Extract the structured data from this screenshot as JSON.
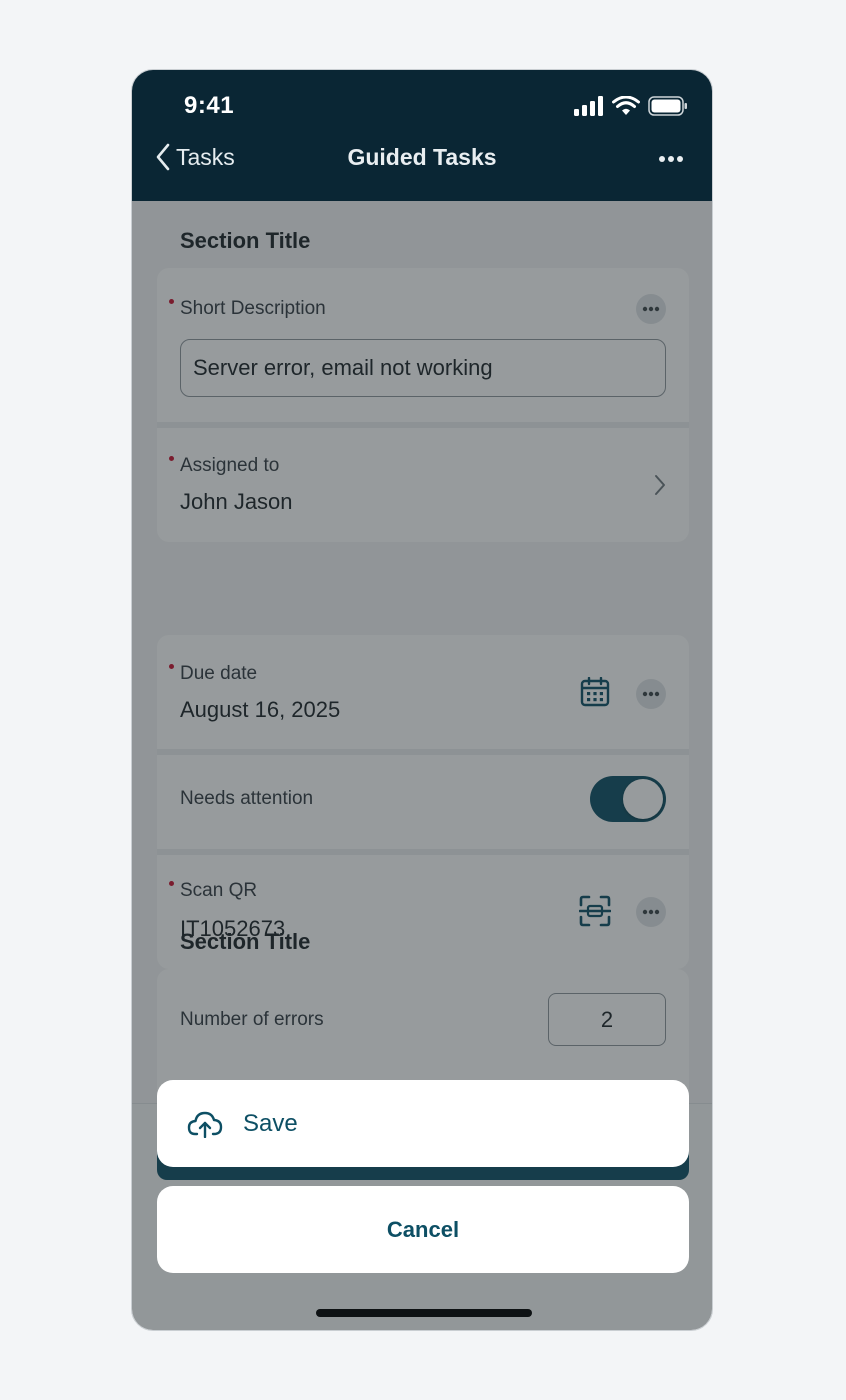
{
  "status_bar": {
    "time": "9:41"
  },
  "nav": {
    "back_label": "Tasks",
    "title": "Guided Tasks"
  },
  "sections": [
    {
      "title": "Section Title",
      "fields": {
        "short_description": {
          "label": "Short Description",
          "value": "Server error, email not working"
        },
        "assigned_to": {
          "label": "Assigned to",
          "value": "John Jason"
        }
      }
    },
    {
      "fields": {
        "due_date": {
          "label": "Due date",
          "value": "August 16, 2025"
        },
        "needs_attention": {
          "label": "Needs attention",
          "toggle_on": true
        },
        "scan_qr": {
          "label": "Scan QR",
          "value": "IT1052673"
        }
      }
    },
    {
      "title": "Section Title",
      "fields": {
        "number_of_errors": {
          "label": "Number of errors",
          "value": "2"
        }
      }
    }
  ],
  "action_sheet": {
    "save_label": "Save",
    "cancel_label": "Cancel"
  },
  "colors": {
    "header": "#0a2634",
    "accent": "#0d4f64",
    "required": "#c8102e"
  }
}
